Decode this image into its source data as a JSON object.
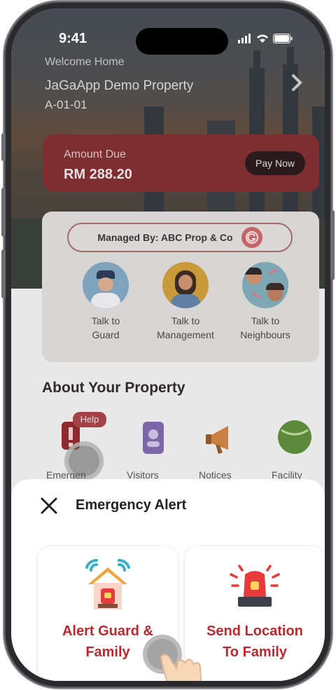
{
  "status_bar": {
    "time": "9:41"
  },
  "header": {
    "welcome": "Welcome Home",
    "property_name": "JaGaApp Demo Property",
    "unit": "A-01-01"
  },
  "billing": {
    "label": "Amount Due",
    "amount": "RM 288.20",
    "pay_button": "Pay Now"
  },
  "management": {
    "managed_by": "Managed By: ABC Prop & Co",
    "talk": [
      {
        "label_line1": "Talk to",
        "label_line2": "Guard",
        "icon": "guard-icon"
      },
      {
        "label_line1": "Talk to",
        "label_line2": "Management",
        "icon": "management-icon"
      },
      {
        "label_line1": "Talk to",
        "label_line2": "Neighbours",
        "icon": "neighbours-icon"
      }
    ]
  },
  "about": {
    "title": "About Your Property",
    "help_badge": "Help",
    "features": [
      {
        "label": "Emergen",
        "icon": "emergency-icon"
      },
      {
        "label": "Visitors",
        "icon": "visitors-icon"
      },
      {
        "label": "Notices",
        "icon": "megaphone-icon"
      },
      {
        "label": "Facility",
        "icon": "facility-icon"
      }
    ]
  },
  "sheet": {
    "title": "Emergency Alert",
    "options": [
      {
        "line1": "Alert Guard &",
        "line2": "Family",
        "icon": "house-alarm-icon"
      },
      {
        "line1": "Send Location",
        "line2": "To Family",
        "icon": "siren-icon"
      }
    ]
  },
  "colors": {
    "accent_red": "#c0262d",
    "due_card": "#7e2d30",
    "sheet_bg": "#ffffff"
  }
}
